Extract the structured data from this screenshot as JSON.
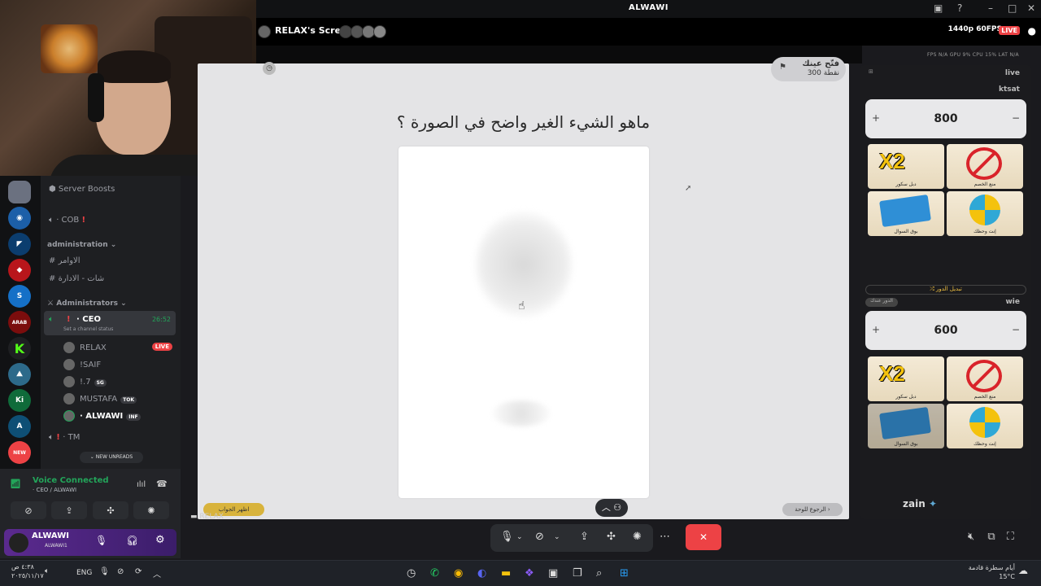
{
  "window": {
    "title": "ALWAWI"
  },
  "stream": {
    "sharer_label": "RELAX's Screen",
    "quality": "1440p 60FPS",
    "live_badge": "LIVE",
    "stats": "FPS N/A   GPU 9%   CPU 15%   LAT N/A",
    "stage_owner_tag": "RELAX"
  },
  "game": {
    "question": "ماهو الشيء الغير واضح في الصورة ؟",
    "score_title": "فتّح عينك",
    "score_points": "300 نقطة",
    "show_answer_btn": "اظهر الجواب",
    "back_btn": "الرجوع للوحة"
  },
  "right_panel": {
    "header_left": "live",
    "team1": {
      "name": "ktsat",
      "score": "800",
      "plus": "+",
      "minus": "−"
    },
    "swap_label": "⤮ تبديل الدور",
    "turn_label": "الدور عندك",
    "team2": {
      "name": "wie",
      "score": "600",
      "plus": "+",
      "minus": "−"
    },
    "powerups": [
      {
        "label": "دبل سكور",
        "kind": "x2",
        "text": "X2"
      },
      {
        "label": "منع الخصم",
        "kind": "ban"
      },
      {
        "label": "بوق السوال",
        "kind": "cards"
      },
      {
        "label": "إنت وحظك",
        "kind": "wheel"
      }
    ],
    "sponsor": "zain"
  },
  "sidebar": {
    "server_boosts": "Server Boosts",
    "cob": "· COB",
    "cat_admin": "administration",
    "ch_orders": "الاوامر",
    "ch_chat": "شات - الادارة",
    "cat_administrators": "Administrators",
    "ceo": "· CEO",
    "ceo_time": "26:52",
    "ceo_status": "Set a channel status",
    "users": [
      {
        "name": "RELAX",
        "tag": ""
      },
      {
        "name": "!SAIF",
        "tag": ""
      },
      {
        "name": "!.7",
        "tag": "SG"
      },
      {
        "name": "MUSTAFA",
        "tag": "TOK"
      },
      {
        "name": "· ALWAWI",
        "tag": "INF"
      }
    ],
    "live_badge": "LIVE",
    "tm": "· TM",
    "new_unreads": "NEW UNREADS"
  },
  "voice": {
    "status": "Voice Connected",
    "channel": "· CEO / ALWAWI"
  },
  "user": {
    "name": "ALWAWI",
    "sub": "ALWAWI1"
  },
  "taskbar": {
    "lang": "ENG",
    "clock_time": "٤:٣٨ ص",
    "clock_date": "٢٠٢٥/١١/١٧",
    "weather_text": "أيام سطرة قادمة",
    "weather_temp": "15°C"
  }
}
